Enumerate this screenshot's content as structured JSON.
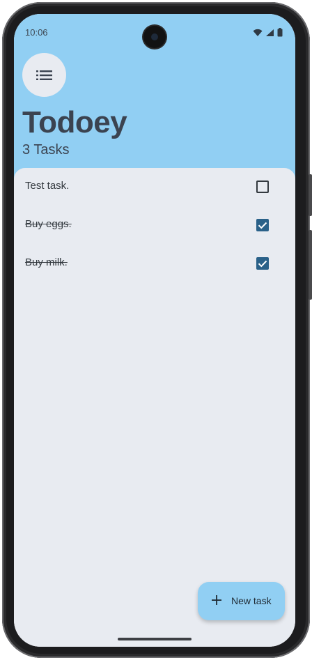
{
  "status_bar": {
    "time": "10:06",
    "icons": [
      "wifi-icon",
      "signal-icon",
      "battery-icon"
    ]
  },
  "header": {
    "menu_icon": "list-icon",
    "title": "Todoey",
    "task_count": "3 Tasks"
  },
  "tasks": [
    {
      "label": "Test task.",
      "done": false
    },
    {
      "label": "Buy eggs.",
      "done": true
    },
    {
      "label": "Buy milk.",
      "done": true
    }
  ],
  "fab": {
    "icon": "plus-icon",
    "label": "New task"
  },
  "colors": {
    "header_bg": "#91cff3",
    "sheet_bg": "#e8ebf1",
    "checkbox_checked": "#2a6189",
    "title_text": "#3b4350"
  }
}
